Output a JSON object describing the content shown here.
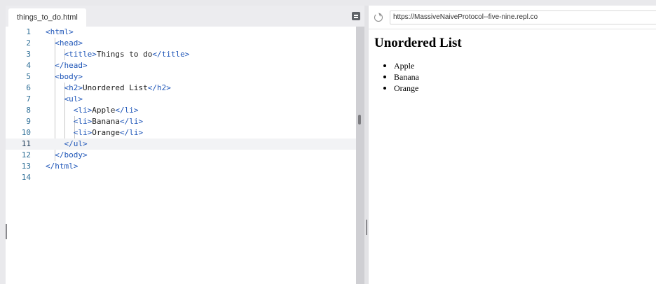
{
  "editor": {
    "tab_label": "things_to_do.html",
    "active_line": 11,
    "lines": [
      {
        "num": "1",
        "code": "<html>"
      },
      {
        "num": "2",
        "code": "  <head>"
      },
      {
        "num": "3",
        "code": "    <title>Things to do</title>"
      },
      {
        "num": "4",
        "code": "  </head>"
      },
      {
        "num": "5",
        "code": "  <body>"
      },
      {
        "num": "6",
        "code": "    <h2>Unordered List</h2>"
      },
      {
        "num": "7",
        "code": "    <ul>"
      },
      {
        "num": "8",
        "code": "      <li>Apple</li>"
      },
      {
        "num": "9",
        "code": "      <li>Banana</li>"
      },
      {
        "num": "10",
        "code": "      <li>Orange</li>"
      },
      {
        "num": "11",
        "code": "    </ul>"
      },
      {
        "num": "12",
        "code": "  </body>"
      },
      {
        "num": "13",
        "code": "</html>"
      },
      {
        "num": "14",
        "code": ""
      }
    ]
  },
  "preview": {
    "url": "https://MassiveNaiveProtocol--five-nine.repl.co",
    "heading": "Unordered List",
    "items": [
      "Apple",
      "Banana",
      "Orange"
    ]
  },
  "icons": {
    "panel_toggle": "panel-toggle-icon",
    "reload": "reload-icon"
  },
  "colors": {
    "tag": "#1f56b8",
    "line_number": "#2f6f97",
    "active_line_bg": "#f2f3f5"
  }
}
